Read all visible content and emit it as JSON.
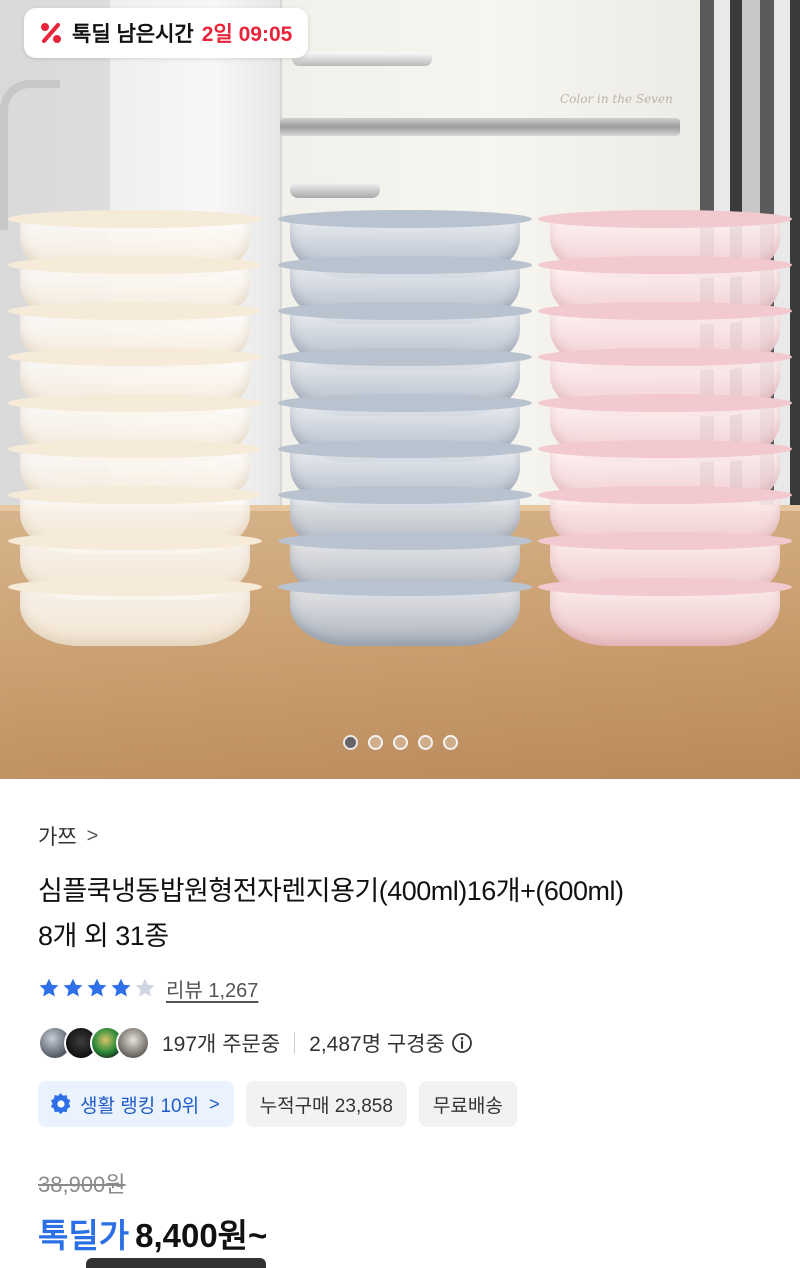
{
  "timer": {
    "label": "톡딜 남은시간",
    "value": "2일 09:05"
  },
  "carousel": {
    "total": 5,
    "active_index": 0
  },
  "product": {
    "brand": "가쯔",
    "title_line1": "심플쿡냉동밥원형전자렌지용기(400ml)16개+(600ml)",
    "title_line2": "8개 외 31종",
    "rating": 4,
    "review_label": "리뷰 1,267",
    "ordering_text": "197개 주문중",
    "watching_text": "2,487명 구경중",
    "chips": {
      "ranking": "생활 랭킹 10위",
      "cumulative": "누적구매 23,858",
      "shipping": "무료배송"
    },
    "original_price": "38,900원",
    "deal_label": "톡딜가",
    "deal_price": "8,400원~"
  },
  "colors": {
    "accent_red": "#e8243a",
    "accent_blue": "#2a6fe6",
    "star_blue": "#2f6fe8"
  },
  "icons": [
    "discount-icon",
    "chevron-right-icon",
    "star-icon",
    "info-icon",
    "ranking-badge-icon"
  ]
}
